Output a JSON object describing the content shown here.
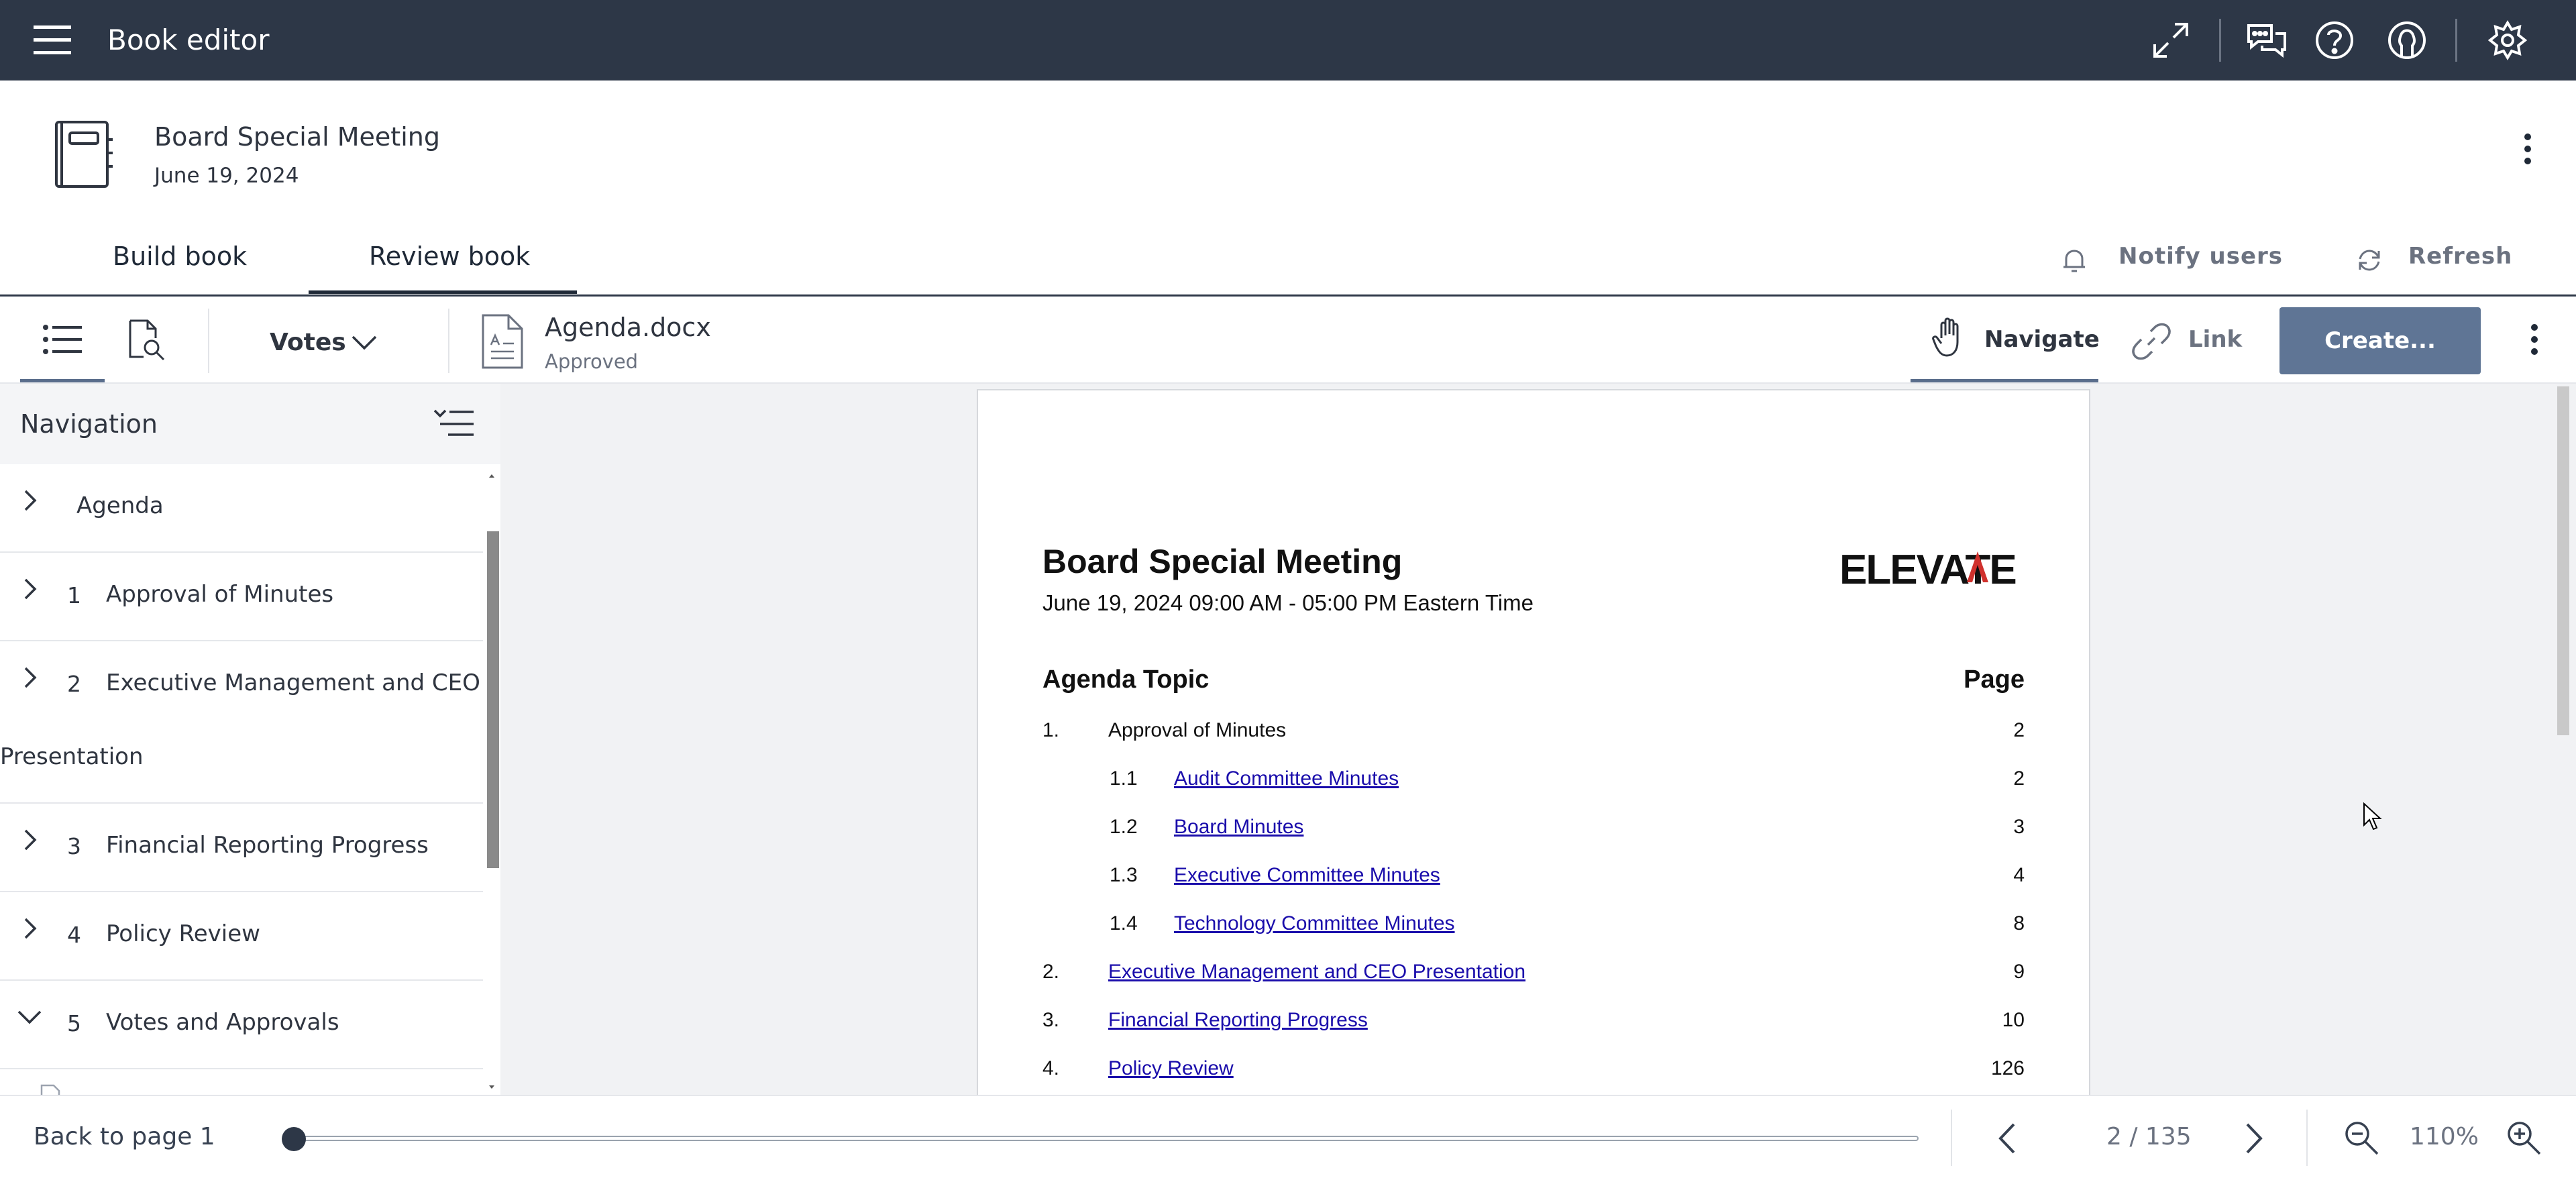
{
  "topbar": {
    "title": "Book editor",
    "icons": [
      "menu-icon",
      "expand-icon",
      "chat-icon",
      "help-icon",
      "account-icon",
      "settings-icon"
    ]
  },
  "header": {
    "title": "Board Special Meeting",
    "date": "June 19, 2024"
  },
  "tabs": [
    {
      "label": "Build book",
      "active": false
    },
    {
      "label": "Review book",
      "active": true
    }
  ],
  "actions": {
    "notify": "Notify users",
    "refresh": "Refresh"
  },
  "toolbar": {
    "filter_label": "Votes",
    "document_name": "Agenda.docx",
    "document_status": "Approved",
    "navigate_label": "Navigate",
    "link_label": "Link",
    "create_label": "Create..."
  },
  "navigation": {
    "title": "Navigation",
    "items": [
      {
        "number": "",
        "label": "Agenda",
        "expanded": false
      },
      {
        "number": "1",
        "label": "Approval of Minutes",
        "expanded": false
      },
      {
        "number": "2",
        "label": "Executive Management and CEO",
        "label_cont": "Presentation",
        "expanded": false
      },
      {
        "number": "3",
        "label": "Financial Reporting Progress",
        "expanded": false
      },
      {
        "number": "4",
        "label": "Policy Review",
        "expanded": false
      },
      {
        "number": "5",
        "label": "Votes and Approvals",
        "expanded": true
      }
    ]
  },
  "document_page": {
    "title": "Board Special Meeting",
    "subtitle": "June 19, 2024 09:00 AM - 05:00 PM Eastern Time",
    "logo": "ELEVATE",
    "col_topic": "Agenda Topic",
    "col_page": "Page",
    "rows": [
      {
        "num": "1.",
        "label": "Approval of Minutes",
        "page": "2",
        "indent": false,
        "link": false
      },
      {
        "num": "1.1",
        "label": "Audit Committee Minutes",
        "page": "2",
        "indent": true,
        "link": true
      },
      {
        "num": "1.2",
        "label": "Board Minutes",
        "page": "3",
        "indent": true,
        "link": true
      },
      {
        "num": "1.3",
        "label": "Executive Committee Minutes",
        "page": "4",
        "indent": true,
        "link": true
      },
      {
        "num": "1.4",
        "label": "Technology Committee Minutes",
        "page": "8",
        "indent": true,
        "link": true
      },
      {
        "num": "2.",
        "label": "Executive Management and CEO Presentation",
        "page": "9",
        "indent": false,
        "link": true
      },
      {
        "num": "3.",
        "label": "Financial Reporting Progress",
        "page": "10",
        "indent": false,
        "link": true
      },
      {
        "num": "4.",
        "label": "Policy Review",
        "page": "126",
        "indent": false,
        "link": true
      }
    ]
  },
  "bottombar": {
    "back_label": "Back to page 1",
    "page_indicator": "2 / 135",
    "zoom": "110%",
    "slider_position": 0.0
  },
  "colors": {
    "topbar": "#2d3747",
    "create_button": "#5f7595",
    "link": "#1a0dab",
    "accent_underline": "#5a6e8c"
  }
}
